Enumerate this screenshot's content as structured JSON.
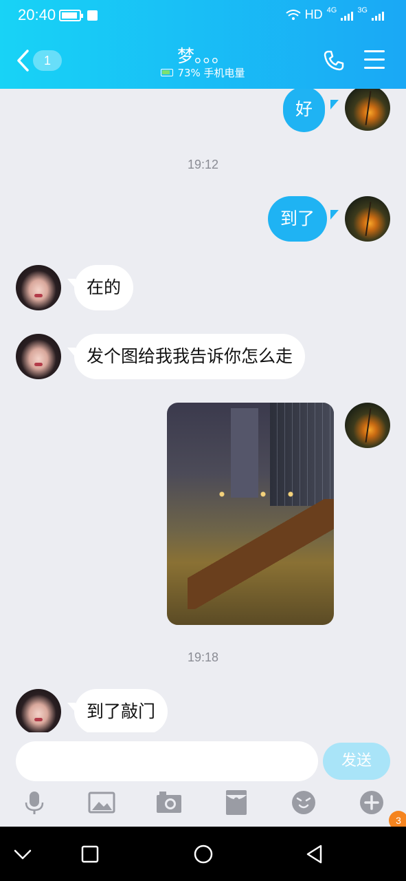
{
  "status_bar": {
    "time": "20:40",
    "network": "HD",
    "net_4g": "4G",
    "net_3g": "3G"
  },
  "header": {
    "unread_count": "1",
    "contact_name": "梦。。。",
    "battery_status": "73% 手机电量"
  },
  "timestamps": [
    "19:12",
    "19:18"
  ],
  "messages": [
    {
      "side": "self",
      "text": "好"
    },
    {
      "side": "self",
      "text": "到了"
    },
    {
      "side": "other",
      "text": "在的"
    },
    {
      "side": "other",
      "text": "发个图给我我告诉你怎么走"
    },
    {
      "side": "self",
      "type": "image"
    },
    {
      "side": "other",
      "text": "到了敲门"
    }
  ],
  "input": {
    "value": "",
    "placeholder": ""
  },
  "send_label": "发送",
  "toolbar_icons": [
    "microphone-icon",
    "image-icon",
    "camera-icon",
    "red-packet-icon",
    "emoji-icon",
    "plus-icon"
  ],
  "notification_badge": "3",
  "colors": {
    "header_start": "#18d3f6",
    "header_end": "#1aa8f5",
    "bubble_self": "#1fb3f3",
    "bubble_other": "#ffffff",
    "background": "#ecedf2"
  }
}
